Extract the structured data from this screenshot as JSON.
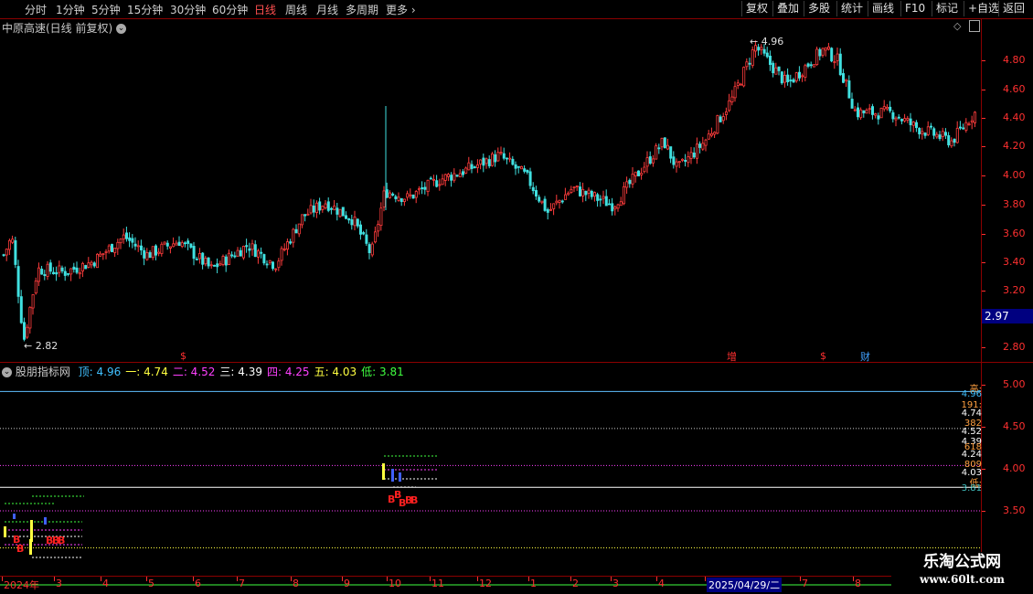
{
  "toolbar": {
    "periods": [
      "分时",
      "1分钟",
      "5分钟",
      "15分钟",
      "30分钟",
      "60分钟",
      "日线",
      "周线",
      "月线",
      "多周期",
      "更多"
    ],
    "active_period": "日线",
    "right_buttons": [
      "复权",
      "叠加",
      "多股",
      "统计",
      "画线",
      "F10",
      "标记",
      "+自选",
      "返回"
    ]
  },
  "main_chart": {
    "title": "中原高速(日线 前复权)",
    "y_ticks": [
      "4.80",
      "4.60",
      "4.40",
      "4.20",
      "4.00",
      "3.80",
      "3.60",
      "3.40",
      "3.20",
      "2.80"
    ],
    "current_price": "2.97",
    "high_label": "4.96",
    "low_label": "2.82",
    "markers": [
      "$",
      "增",
      "$",
      "财"
    ]
  },
  "indicator": {
    "name": "股朋指标网",
    "items": [
      {
        "label": "顶:",
        "value": "4.96",
        "color": "#40c0ff"
      },
      {
        "label": "一:",
        "value": "4.74",
        "color": "#ffff40"
      },
      {
        "label": "二:",
        "value": "4.52",
        "color": "#ff40ff"
      },
      {
        "label": "三:",
        "value": "4.39",
        "color": "#ffffff"
      },
      {
        "label": "四:",
        "value": "4.25",
        "color": "#ff40ff"
      },
      {
        "label": "五:",
        "value": "4.03",
        "color": "#ffff40"
      },
      {
        "label": "低:",
        "value": "3.81",
        "color": "#40ff40"
      }
    ],
    "y_ticks": [
      "5.00",
      "4.50",
      "4.00",
      "3.50"
    ],
    "right_labels": [
      "高:",
      "4.96",
      "191:",
      "4.74",
      "382",
      "4.52",
      "",
      "4.39",
      "618",
      "4.24",
      "809",
      "4.03",
      "低:",
      "3.81"
    ],
    "buy_letter": "B"
  },
  "date_axis": [
    "2024年",
    "3",
    "4",
    "5",
    "6",
    "7",
    "8",
    "9",
    "10",
    "11",
    "12",
    "1",
    "2",
    "3",
    "4",
    "2025/04/29/二",
    "7",
    "8"
  ],
  "watermark": {
    "line1": "乐淘公式网",
    "line2": "www.60lt.com"
  }
}
